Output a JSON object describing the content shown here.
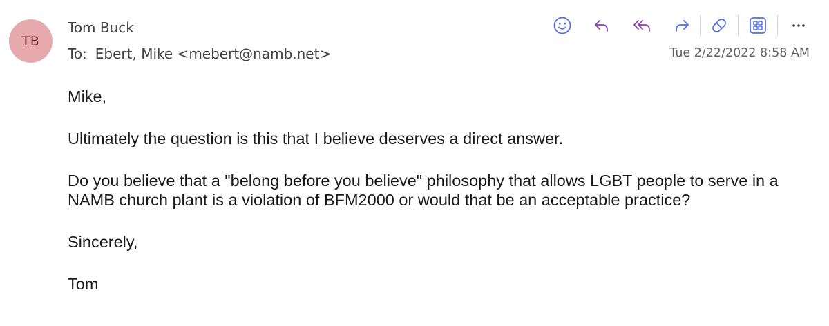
{
  "message": {
    "sender": {
      "initials": "TB",
      "name": "Tom Buck",
      "avatar_color": "#e6a9ad"
    },
    "to_label": "To:",
    "to_value": "Ebert, Mike <mebert@namb.net>",
    "timestamp": "Tue 2/22/2022 8:58 AM",
    "body": {
      "greeting": "Mike,",
      "p1": "Ultimately the question is this that I believe deserves a direct answer.",
      "p2": "Do you believe that a \"belong before you believe\" philosophy that allows LGBT people to serve in a NAMB church plant is a violation of BFM2000 or would that be an acceptable practice?",
      "closing": "Sincerely,",
      "signature": "Tom"
    }
  },
  "toolbar": {
    "icons": [
      "emoji-icon",
      "reply-icon",
      "reply-all-icon",
      "forward-icon",
      "sticker-icon",
      "apps-icon",
      "more-icon"
    ],
    "accent_color": "#4f6bed",
    "reply_color": "#8e3bbd"
  }
}
